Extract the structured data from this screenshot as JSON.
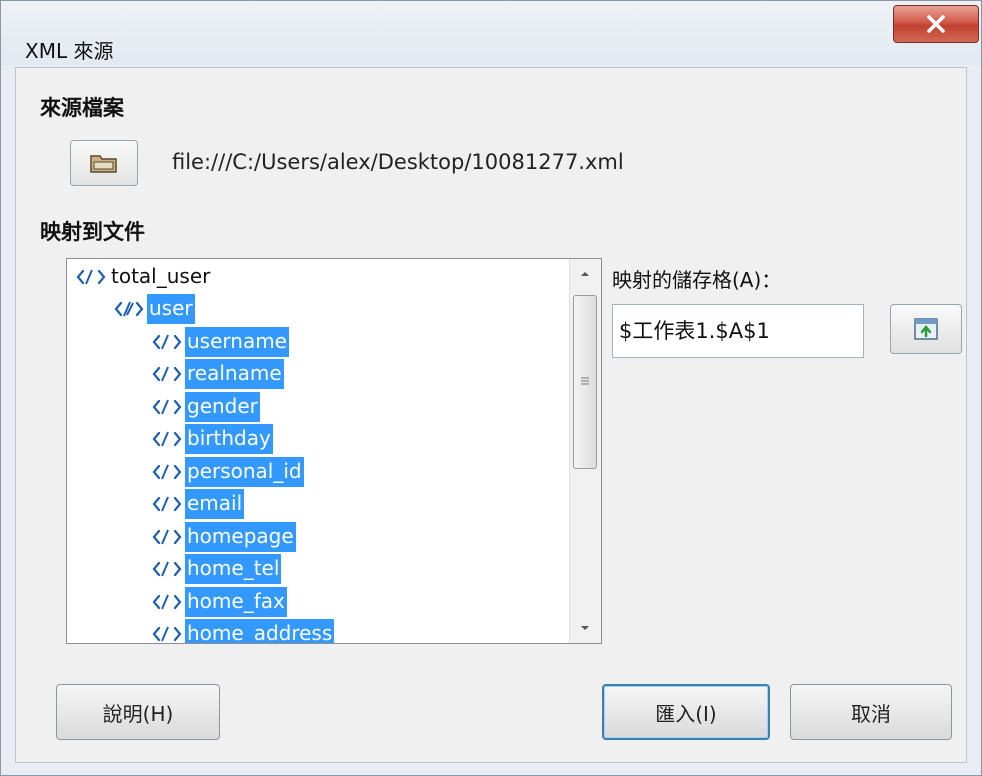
{
  "window": {
    "title": "XML 來源"
  },
  "source": {
    "label": "來源檔案",
    "file_path": "file:///C:/Users/alex/Desktop/10081277.xml"
  },
  "mapping": {
    "label": "映射到文件",
    "tree": [
      {
        "label": "total_user",
        "level": 0,
        "selected": false,
        "icon": "xml-element-icon"
      },
      {
        "label": "user",
        "level": 1,
        "selected": true,
        "icon": "xml-repeating-element-icon"
      },
      {
        "label": "username",
        "level": 2,
        "selected": true,
        "icon": "xml-element-icon"
      },
      {
        "label": "realname",
        "level": 2,
        "selected": true,
        "icon": "xml-element-icon"
      },
      {
        "label": "gender",
        "level": 2,
        "selected": true,
        "icon": "xml-element-icon"
      },
      {
        "label": "birthday",
        "level": 2,
        "selected": true,
        "icon": "xml-element-icon"
      },
      {
        "label": "personal_id",
        "level": 2,
        "selected": true,
        "icon": "xml-element-icon"
      },
      {
        "label": "email",
        "level": 2,
        "selected": true,
        "icon": "xml-element-icon"
      },
      {
        "label": "homepage",
        "level": 2,
        "selected": true,
        "icon": "xml-element-icon"
      },
      {
        "label": "home_tel",
        "level": 2,
        "selected": true,
        "icon": "xml-element-icon"
      },
      {
        "label": "home_fax",
        "level": 2,
        "selected": true,
        "icon": "xml-element-icon"
      },
      {
        "label": "home_address",
        "level": 2,
        "selected": true,
        "icon": "xml-element-icon"
      }
    ]
  },
  "cell": {
    "label": "映射的儲存格(A)：",
    "value": "$工作表1.$A$1"
  },
  "buttons": {
    "help": "說明(H)",
    "import": "匯入(I)",
    "cancel": "取消"
  },
  "colors": {
    "selection": "#3399ff",
    "icon_blue": "#1f5fb0",
    "close_red": "#c2402f"
  }
}
